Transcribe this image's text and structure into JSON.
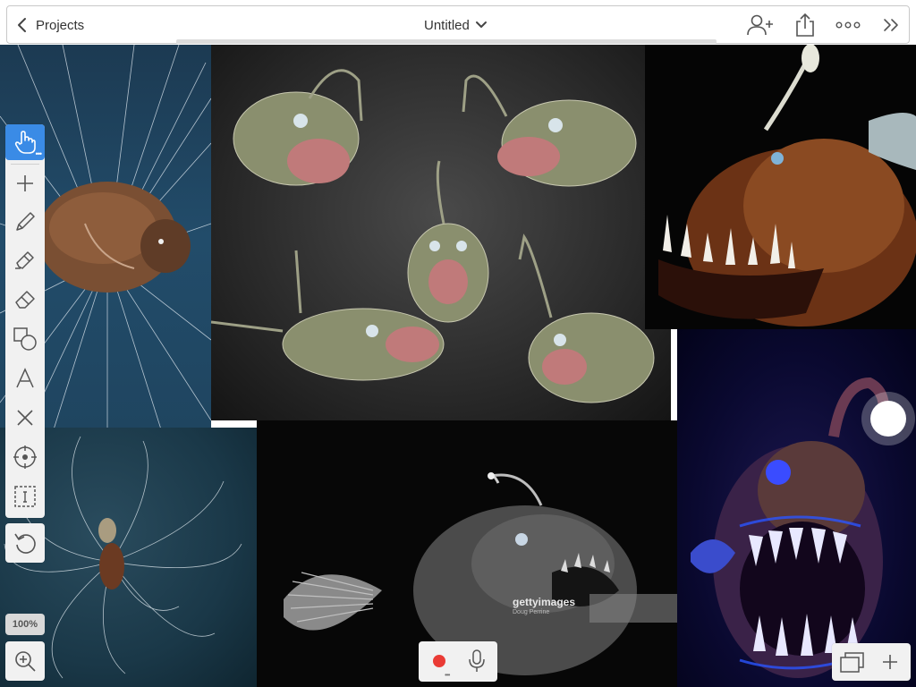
{
  "header": {
    "back_label": "Projects",
    "title": "Untitled"
  },
  "toolbar": {
    "tools": [
      {
        "name": "hand-tool",
        "icon": "hand-pointer-icon",
        "active": true
      },
      {
        "name": "add-tool",
        "icon": "plus-icon"
      },
      {
        "name": "pencil-tool",
        "icon": "pencil-icon"
      },
      {
        "name": "marker-tool",
        "icon": "marker-icon"
      },
      {
        "name": "eraser-tool",
        "icon": "eraser-icon"
      },
      {
        "name": "shape-tool",
        "icon": "shapes-icon"
      },
      {
        "name": "text-tool",
        "icon": "text-a-icon"
      },
      {
        "name": "delete-tool",
        "icon": "close-x-icon"
      },
      {
        "name": "target-tool",
        "icon": "crosshair-icon"
      },
      {
        "name": "select-tool",
        "icon": "selection-icon"
      }
    ],
    "undo_icon": "undo-icon",
    "zoom_level": "100%",
    "zoom_icon": "zoom-in-icon"
  },
  "canvas": {
    "watermark": {
      "brand": "gettyimages",
      "credit": "Doug Perrine"
    }
  },
  "recorder": {
    "record_icon": "record-dot-icon",
    "mic_icon": "microphone-icon"
  },
  "pages": {
    "pages_icon": "pages-icon",
    "add_icon": "plus-icon"
  },
  "colors": {
    "accent": "#3a8be6",
    "record_red": "#ea3b35",
    "toolbar_bg": "#f1f1f1"
  }
}
